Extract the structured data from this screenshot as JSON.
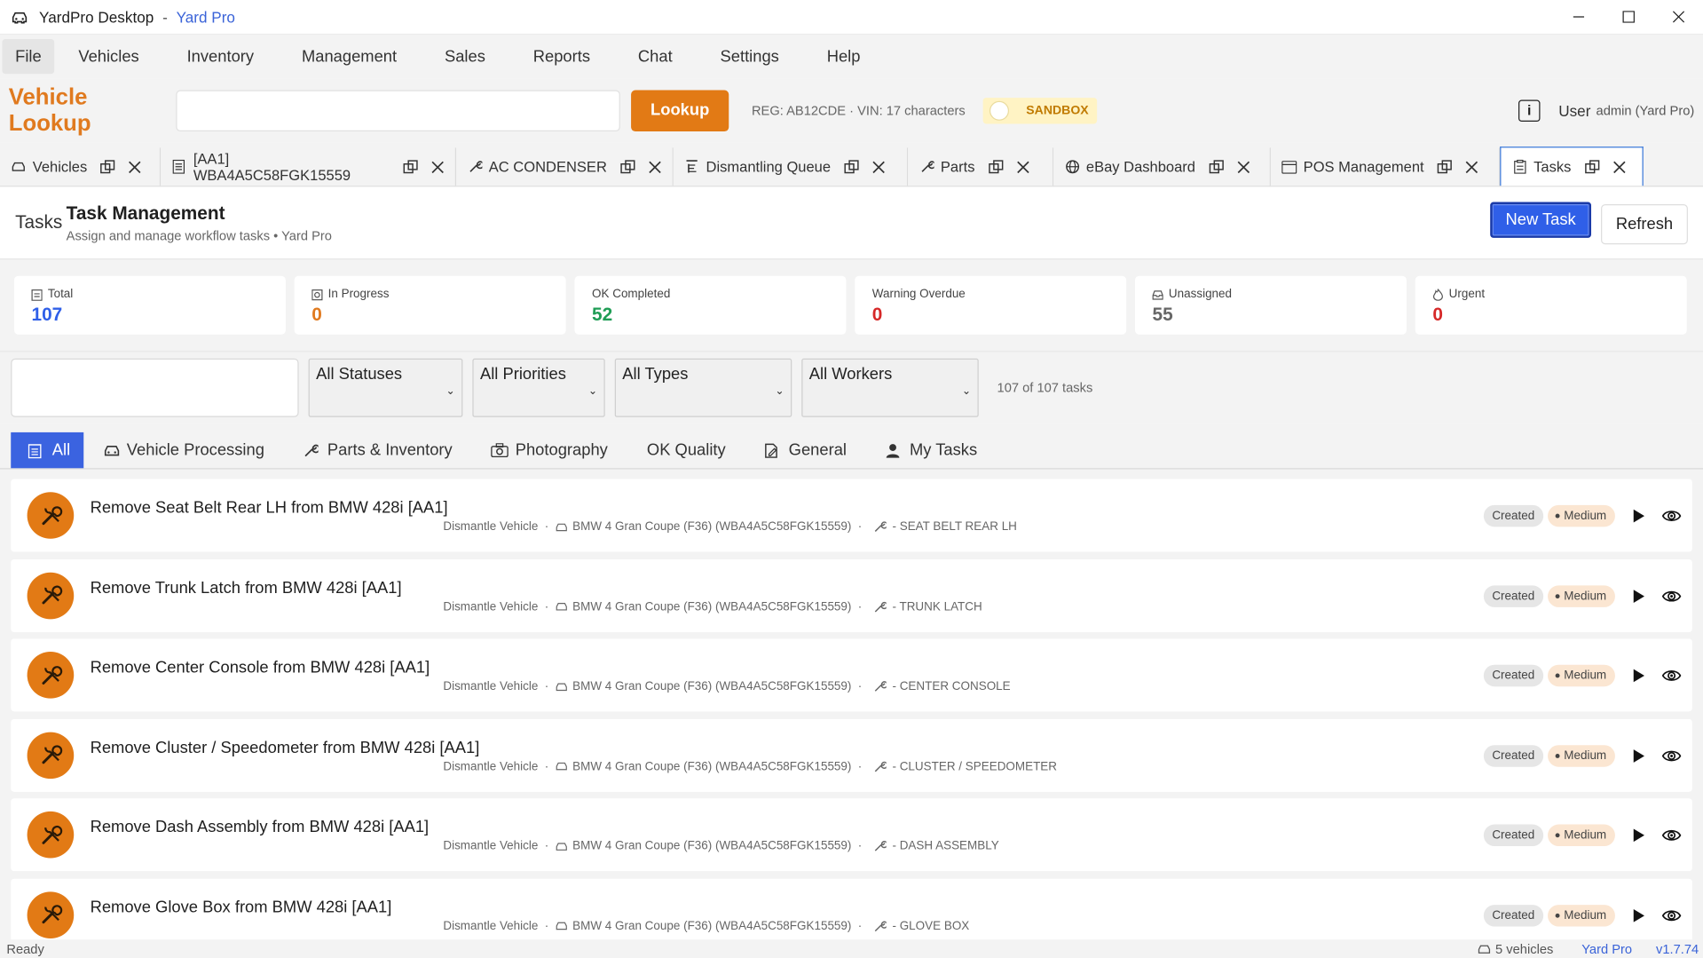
{
  "window": {
    "app_name": "YardPro Desktop",
    "separator": "-",
    "brand": "Yard Pro"
  },
  "menu": [
    "File",
    "Vehicles",
    "Inventory",
    "Management",
    "Sales",
    "Reports",
    "Chat",
    "Settings",
    "Help"
  ],
  "lookup": {
    "title": "Vehicle Lookup",
    "input_value": "",
    "button": "Lookup",
    "hint": "REG: AB12CDE  ·  VIN: 17 characters",
    "sandbox_label": "SANDBOX",
    "user_label": "User",
    "user_name": "admin (Yard Pro)"
  },
  "tabs": [
    {
      "label": "Vehicles",
      "icon": "car-icon"
    },
    {
      "label": "[AA1] WBA4A5C58FGK15559",
      "icon": "document-icon"
    },
    {
      "label": "AC CONDENSER",
      "icon": "wrench-icon"
    },
    {
      "label": "Dismantling Queue",
      "icon": "queue-icon"
    },
    {
      "label": "Parts",
      "icon": "wrench-icon"
    },
    {
      "label": "eBay Dashboard",
      "icon": "globe-icon"
    },
    {
      "label": "POS Management",
      "icon": "pos-icon"
    },
    {
      "label": "Tasks",
      "icon": "clipboard-icon",
      "active": true
    }
  ],
  "header": {
    "crumb": "Tasks",
    "title": "Task Management",
    "subtitle": "Assign and manage workflow tasks • Yard Pro",
    "new_task": "New Task",
    "refresh": "Refresh"
  },
  "stats": [
    {
      "label": "Total",
      "value": "107",
      "color": "#2f5fe8",
      "icon": "clipboard-icon"
    },
    {
      "label": "In Progress",
      "value": "0",
      "color": "#e07a1f",
      "icon": "progress-icon"
    },
    {
      "label": "OK Completed",
      "value": "52",
      "color": "#1f9d55",
      "icon": ""
    },
    {
      "label": "Warning Overdue",
      "value": "0",
      "color": "#d62828",
      "icon": ""
    },
    {
      "label": "Unassigned",
      "value": "55",
      "color": "#666666",
      "icon": "inbox-icon"
    },
    {
      "label": "Urgent",
      "value": "0",
      "color": "#d62828",
      "icon": "flame-icon"
    }
  ],
  "filters": {
    "search_value": "",
    "status": "All Statuses",
    "priority": "All Priorities",
    "type": "All Types",
    "worker": "All Workers",
    "count": "107 of 107 tasks"
  },
  "categories": [
    {
      "label": "All",
      "icon": "clipboard-icon",
      "active": true
    },
    {
      "label": "Vehicle Processing",
      "icon": "car-icon"
    },
    {
      "label": "Parts & Inventory",
      "icon": "wrench-icon"
    },
    {
      "label": "Photography",
      "icon": "camera-icon"
    },
    {
      "label": "OK Quality",
      "icon": ""
    },
    {
      "label": "General",
      "icon": "edit-icon"
    },
    {
      "label": "My Tasks",
      "icon": "person-icon"
    }
  ],
  "tasks": [
    {
      "title": "Remove Seat Belt Rear LH from BMW 428i [AA1]",
      "type": "Dismantle Vehicle",
      "vehicle": "BMW 4 Gran Coupe (F36) (WBA4A5C58FGK15559)",
      "part": "- SEAT BELT REAR LH",
      "status": "Created",
      "priority": "Medium"
    },
    {
      "title": "Remove Trunk Latch from BMW 428i [AA1]",
      "type": "Dismantle Vehicle",
      "vehicle": "BMW 4 Gran Coupe (F36) (WBA4A5C58FGK15559)",
      "part": "- TRUNK LATCH",
      "status": "Created",
      "priority": "Medium"
    },
    {
      "title": "Remove Center Console from BMW 428i [AA1]",
      "type": "Dismantle Vehicle",
      "vehicle": "BMW 4 Gran Coupe (F36) (WBA4A5C58FGK15559)",
      "part": "- CENTER CONSOLE",
      "status": "Created",
      "priority": "Medium"
    },
    {
      "title": "Remove Cluster / Speedometer from BMW 428i [AA1]",
      "type": "Dismantle Vehicle",
      "vehicle": "BMW 4 Gran Coupe (F36) (WBA4A5C58FGK15559)",
      "part": "- CLUSTER / SPEEDOMETER",
      "status": "Created",
      "priority": "Medium"
    },
    {
      "title": "Remove Dash Assembly from BMW 428i [AA1]",
      "type": "Dismantle Vehicle",
      "vehicle": "BMW 4 Gran Coupe (F36) (WBA4A5C58FGK15559)",
      "part": "- DASH ASSEMBLY",
      "status": "Created",
      "priority": "Medium"
    },
    {
      "title": "Remove Glove Box from BMW 428i [AA1]",
      "type": "Dismantle Vehicle",
      "vehicle": "BMW 4 Gran Coupe (F36) (WBA4A5C58FGK15559)",
      "part": "- GLOVE BOX",
      "status": "Created",
      "priority": "Medium"
    }
  ],
  "statusbar": {
    "ready": "Ready",
    "vehicles": "5 vehicles",
    "brand": "Yard Pro",
    "version": "v1.7.74"
  },
  "colors": {
    "accent_orange": "#e27a15",
    "accent_blue": "#2f5fe8",
    "brand_blue": "#3a63d8"
  }
}
